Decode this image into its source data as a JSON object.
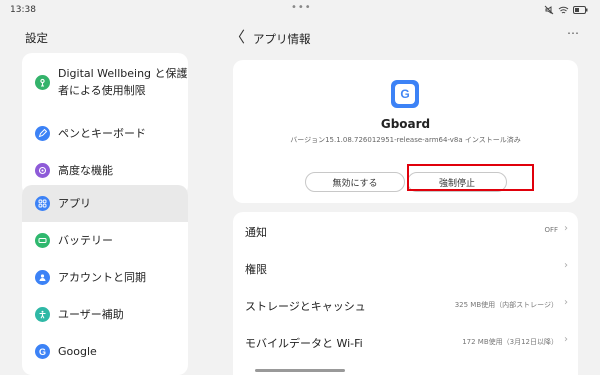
{
  "status_bar": {
    "time": "13:38",
    "dots": "•••"
  },
  "left_panel": {
    "title": "設定",
    "items": [
      {
        "label_line1": "Digital Wellbeing と保護",
        "label_line2": "者による使用制限",
        "icon": "wellbeing-icon",
        "color": "#34b36b"
      },
      {
        "label": "ペンとキーボード",
        "icon": "pen-icon",
        "color": "#3c82f6"
      },
      {
        "label": "高度な機能",
        "icon": "advanced-features-icon",
        "color": "#8e5bd8"
      },
      {
        "label": "アプリ",
        "icon": "apps-grid-icon",
        "color": "#3c82f6",
        "active": true
      },
      {
        "label": "バッテリー",
        "icon": "battery-icon",
        "color": "#2fb86e"
      },
      {
        "label": "アカウントと同期",
        "icon": "account-icon",
        "color": "#3c82f6"
      },
      {
        "label": "ユーザー補助",
        "icon": "accessibility-icon",
        "color": "#2fb8a6"
      },
      {
        "label": "Google",
        "icon": "google-icon",
        "color": "#3c82f6"
      }
    ]
  },
  "header": {
    "back": "〈",
    "title": "アプリ情報",
    "more": "⋯"
  },
  "app": {
    "icon_letter": "G",
    "name": "Gboard",
    "version": "バージョン15.1.08.726012951-release-arm64-v8a インストール済み",
    "disable_label": "無効にする",
    "force_stop_label": "強制停止"
  },
  "rows": [
    {
      "label": "通知",
      "value": "OFF"
    },
    {
      "label": "権限",
      "value": ""
    },
    {
      "label": "ストレージとキャッシュ",
      "value": "325 MB使用（内部ストレージ）"
    },
    {
      "label": "モバイルデータと Wi-Fi",
      "value": "172 MB使用（3月12日以降）"
    }
  ],
  "colors": {
    "accent": "#3c82f6",
    "highlight_box": "#e0000b"
  }
}
